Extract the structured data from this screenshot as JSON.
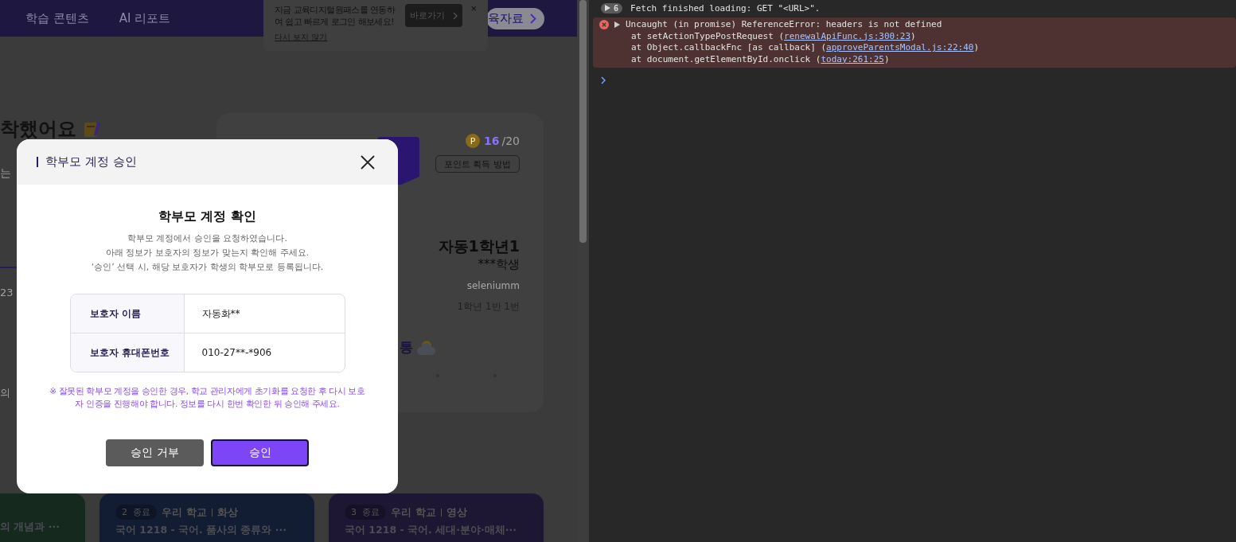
{
  "page": {
    "nav": [
      {
        "label": "학습 콘텐츠",
        "selected": false
      },
      {
        "label": "AI 리포트",
        "selected": false
      }
    ],
    "nav_button": "육자료",
    "login_tip": {
      "message": "지금 교육디지털원패스를 연동하여 쉽고 빠르게 로그인 해보세요!",
      "button": "바로가기",
      "close": "×",
      "dismiss": "다시 보지 않기"
    },
    "heading": "착했어요",
    "subtext": "는",
    "fragment_1": "23",
    "fragment_2": "의",
    "profile_card": {
      "coin": "P",
      "points": "16",
      "points_total": "/20",
      "points_button": "포인트 획득 방법",
      "name": "자동1학년1",
      "role": "***학생",
      "user_id": "seleniumm",
      "class": "1학년 1반 1번",
      "mood": "통"
    },
    "lessons": [
      {
        "title": "의 개념과 ···",
        "color": "#15291f"
      },
      {
        "number": "2",
        "status": "종료",
        "source": "우리 학교",
        "mode": "화상",
        "title": "국어 1218 - 국어. 품사의 종류와 ···",
        "color": "#121c33"
      },
      {
        "number": "3",
        "status": "종료",
        "source": "우리 학교",
        "mode": "영상",
        "title": "국어 1218 - 국어. 세대·분야·매체···",
        "color": "#1e1733"
      }
    ]
  },
  "console": {
    "group_count": "6",
    "fetch_message": "Fetch finished loading: GET \"<URL>\".",
    "error": {
      "message": "Uncaught (in promise) ReferenceError: headers is not defined",
      "expanded": false,
      "stack": [
        {
          "text": "at setActionTypePostRequest (",
          "link": "renewalApiFunc.js:300:23",
          "end": ")"
        },
        {
          "text": "at Object.callbackFnc [as callback] (",
          "link": "approveParentsModal.js:22:40",
          "end": ")"
        },
        {
          "text": "at document.getElementById.onclick (",
          "link": "today:261:25",
          "end": ")"
        }
      ]
    }
  },
  "modal": {
    "title": "학부모 계정 승인",
    "heading": "학부모 계정 확인",
    "description": [
      "학부모 계정에서 승인을 요청하였습니다.",
      "아래 정보가 보호자의 정보가 맞는지 확인해 주세요.",
      "‘승인’ 선택 시, 해당 보호자가 학생의 학부모로 등록됩니다."
    ],
    "fields": [
      {
        "label": "보호자 이름",
        "value": "자동화**"
      },
      {
        "label": "보호자 휴대폰번호",
        "value": "010-27**-*906"
      }
    ],
    "notice": "※ 잘못된 학부모 계정을 승인한 경우, 학교 관리자에게 초기화를 요청한 후 다시 보호자 인증을 진행해야 합니다. 정보를 다시 한번 확인한 뒤 승인해 주세요.",
    "buttons": [
      {
        "label": "승인 거부",
        "kind": "secondary"
      },
      {
        "label": "승인",
        "kind": "primary"
      }
    ]
  }
}
